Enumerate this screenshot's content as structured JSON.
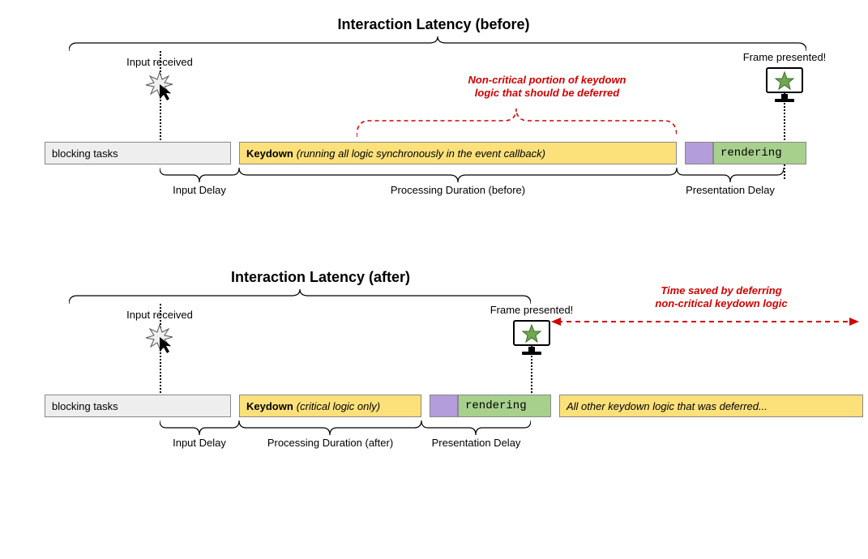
{
  "before": {
    "title": "Interaction Latency (before)",
    "input_received": "Input received",
    "frame_presented": "Frame presented!",
    "red_note_line1": "Non-critical portion of keydown",
    "red_note_line2": "logic that should be deferred",
    "bar_blocking": "blocking tasks",
    "bar_keydown_bold": "Keydown",
    "bar_keydown_ital": "(running all logic synchronously in the event callback)",
    "bar_render": "rendering",
    "under_input_delay": "Input Delay",
    "under_processing": "Processing Duration (before)",
    "under_presentation": "Presentation Delay"
  },
  "after": {
    "title": "Interaction Latency (after)",
    "input_received": "Input received",
    "frame_presented": "Frame presented!",
    "red_note_line1": "Time saved by deferring",
    "red_note_line2": "non-critical keydown logic",
    "bar_blocking": "blocking tasks",
    "bar_keydown_bold": "Keydown",
    "bar_keydown_ital": "(critical logic only)",
    "bar_render": "rendering",
    "bar_deferred": "All other keydown logic that was deferred...",
    "under_input_delay": "Input Delay",
    "under_processing": "Processing Duration (after)",
    "under_presentation": "Presentation Delay"
  }
}
